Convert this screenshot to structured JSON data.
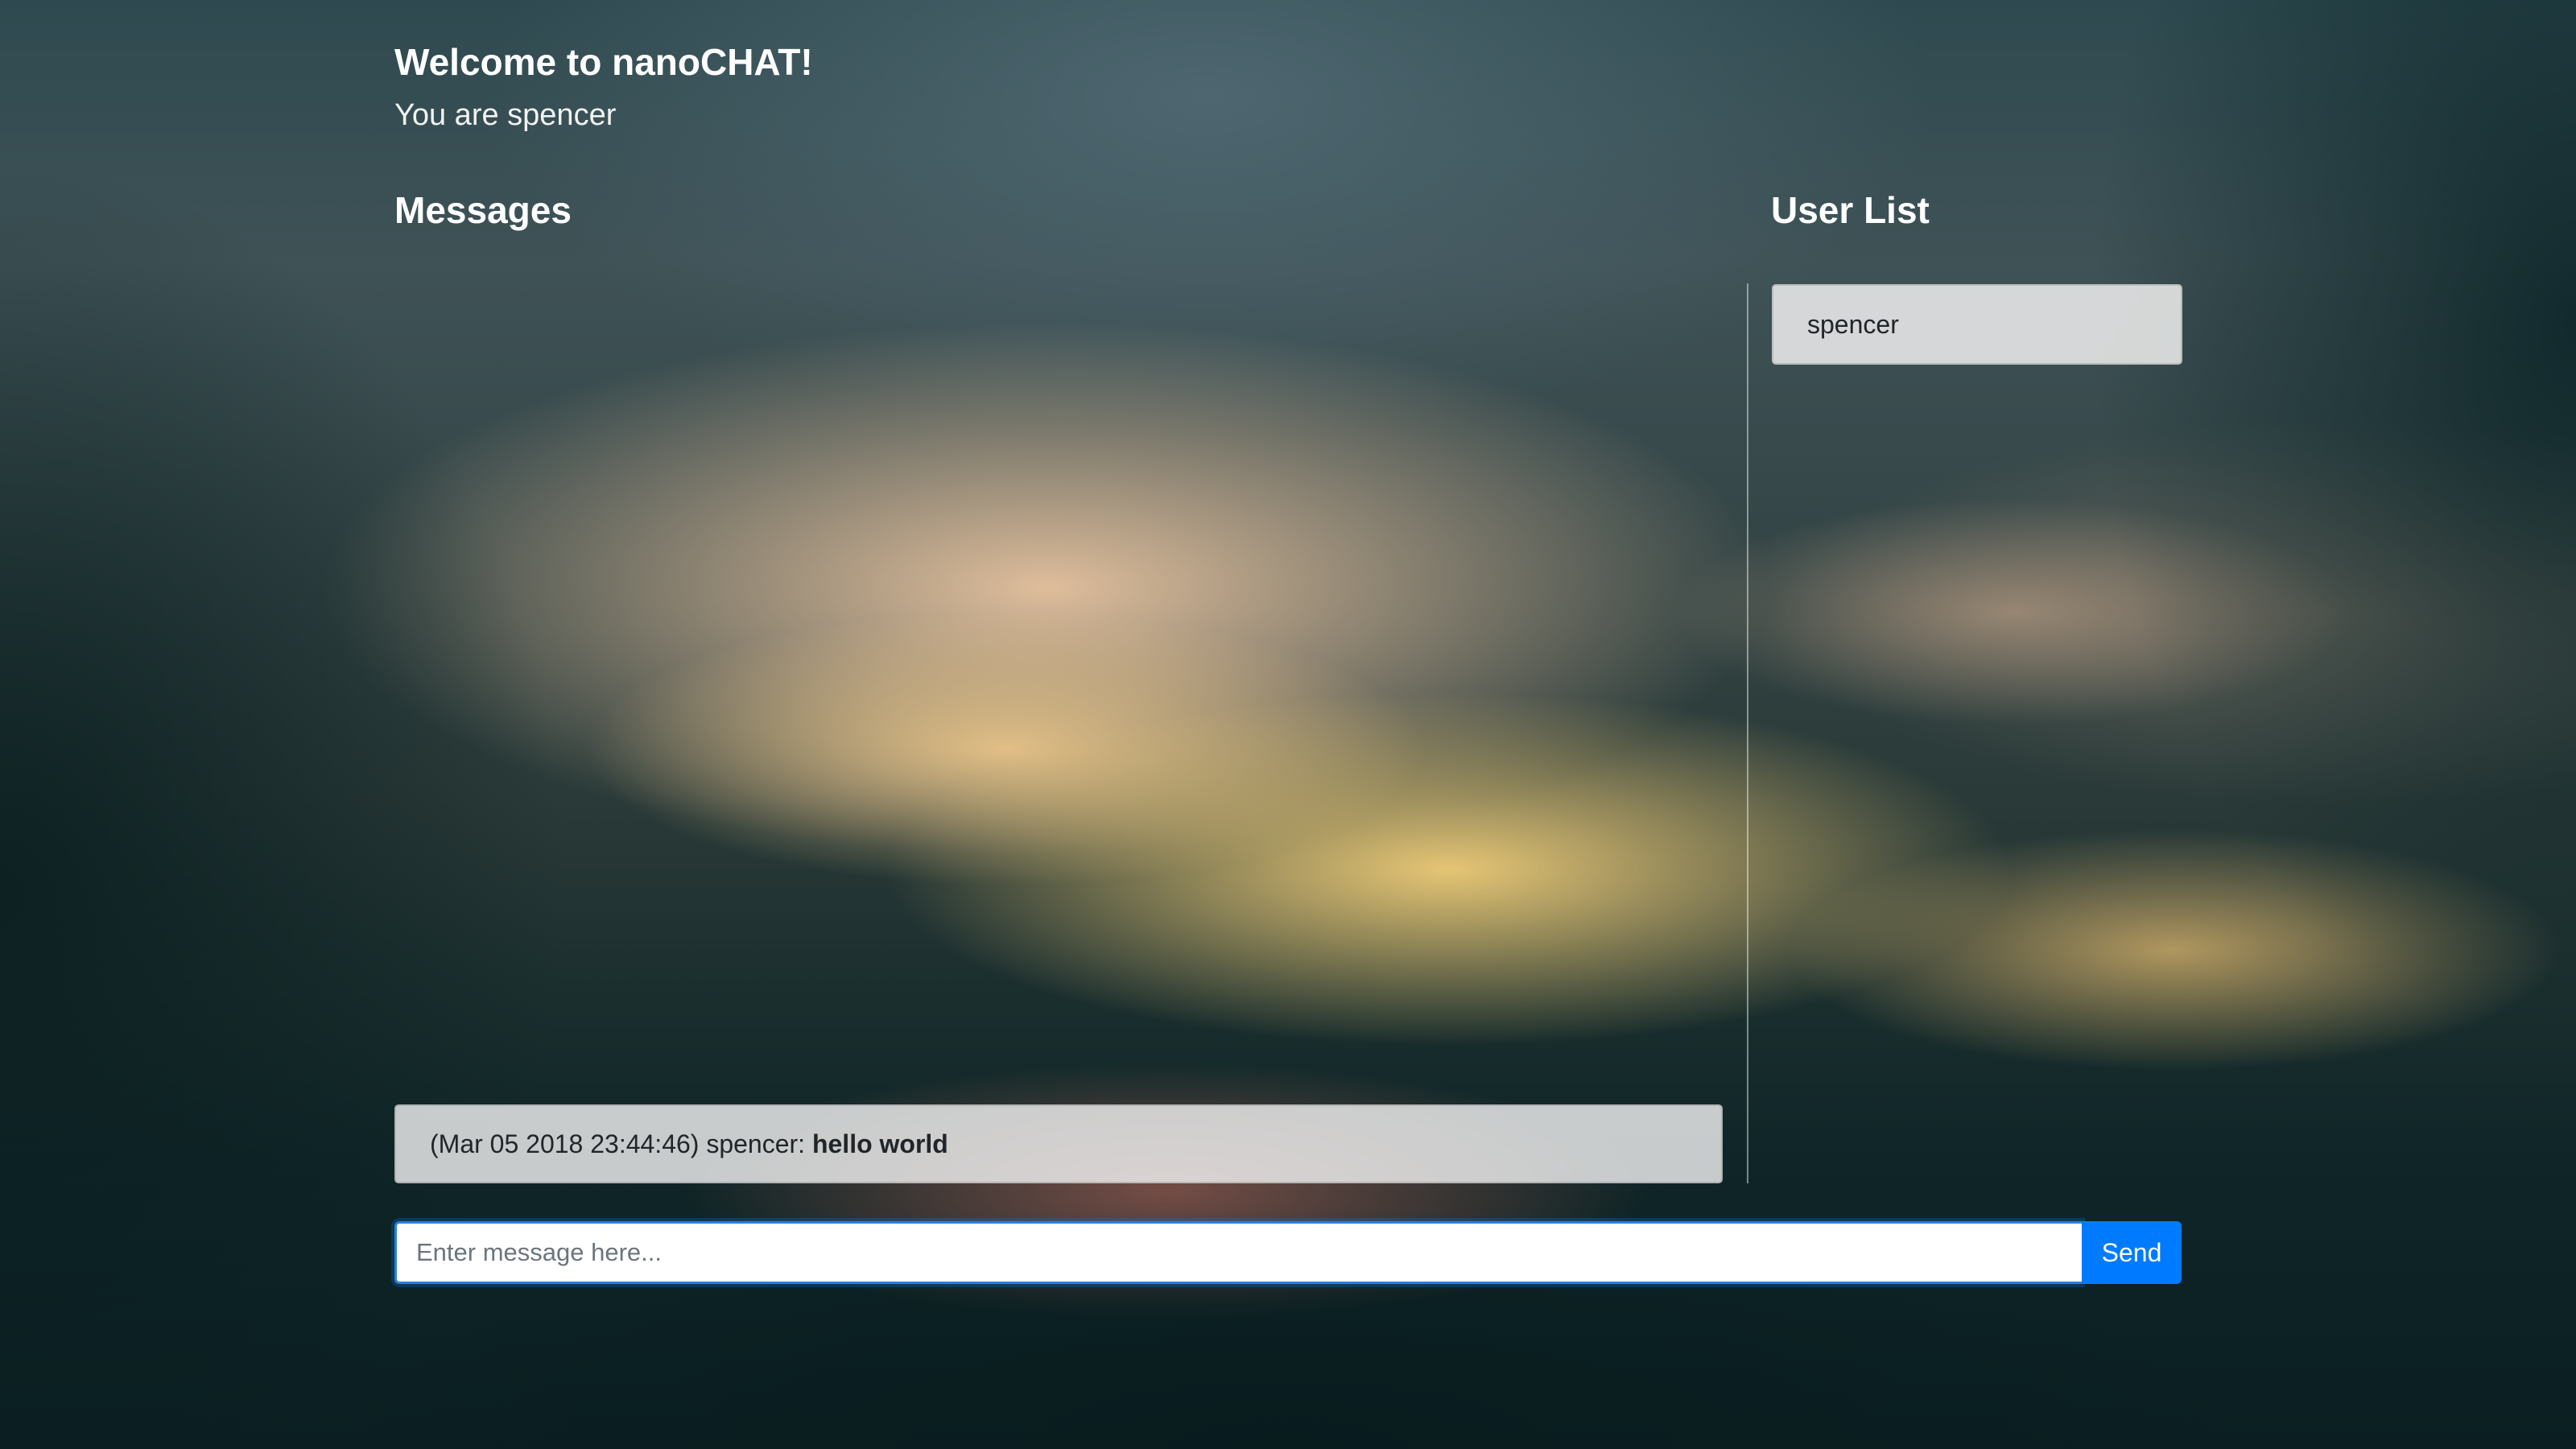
{
  "header": {
    "title": "Welcome to nanoCHAT!",
    "user_line": "You are spencer"
  },
  "messages": {
    "heading": "Messages",
    "items": [
      {
        "timestamp": "(Mar 05 2018 23:44:46)",
        "author": "spencer:",
        "text": "hello world"
      }
    ]
  },
  "user_list": {
    "heading": "User List",
    "users": [
      "spencer"
    ]
  },
  "composer": {
    "placeholder": "Enter message here...",
    "value": "",
    "send_label": "Send"
  },
  "colors": {
    "accent": "#007bff",
    "focus_border": "#2f7fd6"
  }
}
